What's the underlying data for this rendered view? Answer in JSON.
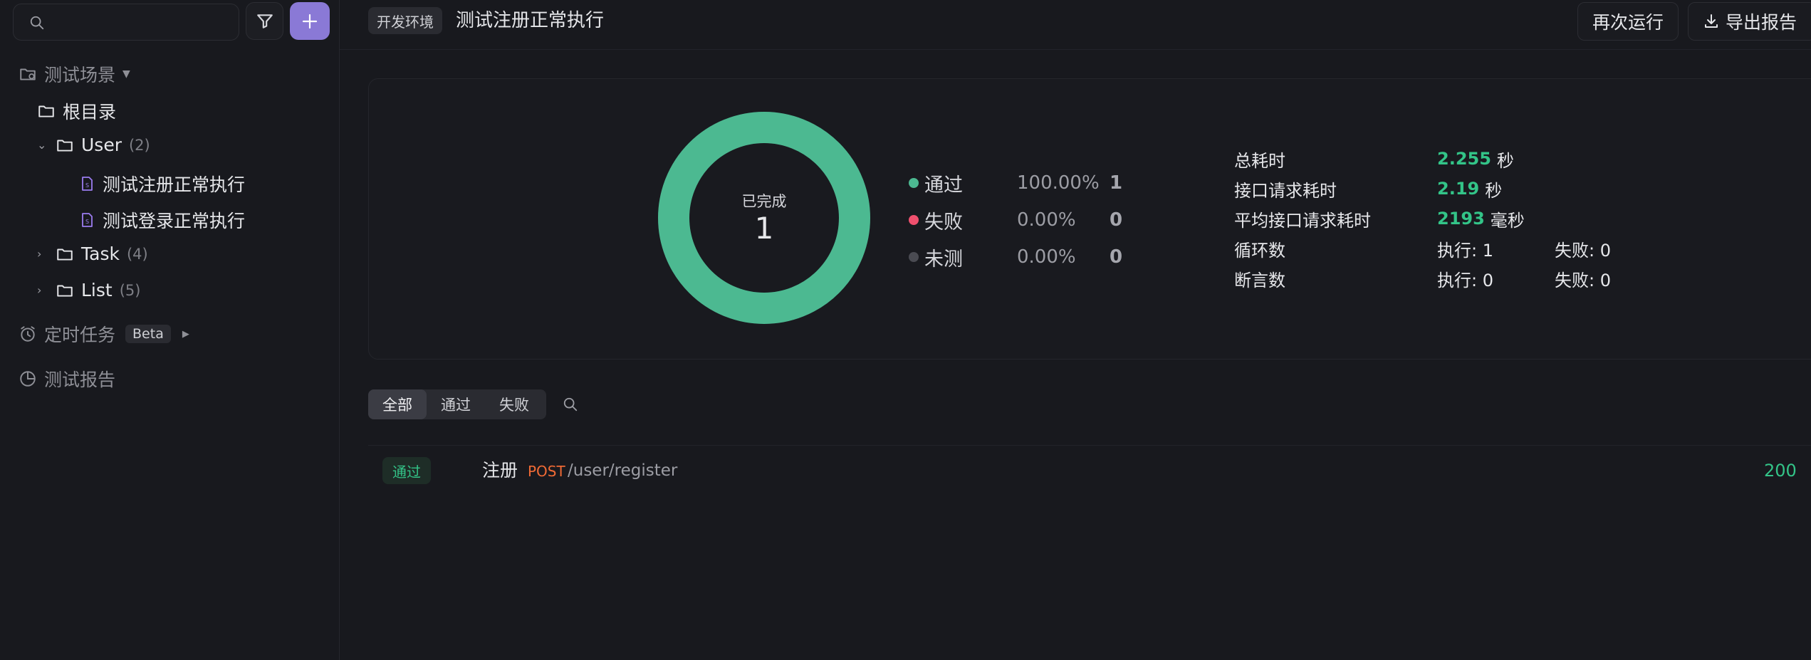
{
  "sidebar": {
    "search": {
      "placeholder": "",
      "value": ""
    },
    "sections": {
      "scenarios": "测试场景",
      "scheduled": "定时任务",
      "beta": "Beta",
      "reports": "测试报告"
    },
    "tree": {
      "root": "根目录",
      "user": {
        "label": "User",
        "count": "(2)"
      },
      "case1": "测试注册正常执行",
      "case2": "测试登录正常执行",
      "task": {
        "label": "Task",
        "count": "(4)"
      },
      "list": {
        "label": "List",
        "count": "(5)"
      }
    }
  },
  "header": {
    "env": "开发环境",
    "title": "测试注册正常执行",
    "rerun": "再次运行",
    "export": "导出报告"
  },
  "summary": {
    "donut": {
      "label": "已完成",
      "value": "1",
      "pass_fraction": 1.0,
      "color": "#4cb991"
    },
    "legend": [
      {
        "label": "通过",
        "pct": "100.00%",
        "count": "1",
        "color": "#4cb991"
      },
      {
        "label": "失败",
        "pct": "0.00%",
        "count": "0",
        "color": "#f0506e"
      },
      {
        "label": "未测",
        "pct": "0.00%",
        "count": "0",
        "color": "#4a4b52"
      }
    ],
    "stats": {
      "total_time": {
        "k": "总耗时",
        "v": "2.255",
        "unit": "秒"
      },
      "req_time": {
        "k": "接口请求耗时",
        "v": "2.19",
        "unit": "秒"
      },
      "avg_time": {
        "k": "平均接口请求耗时",
        "v": "2193",
        "unit": "毫秒"
      },
      "loops": {
        "k": "循环数",
        "exec": "执行: 1",
        "fail": "失败: 0"
      },
      "asserts": {
        "k": "断言数",
        "exec": "执行: 0",
        "fail": "失败: 0"
      }
    }
  },
  "results": {
    "tabs": [
      "全部",
      "通过",
      "失败"
    ],
    "rows": [
      {
        "status": "通过",
        "name": "注册",
        "method": "POST",
        "path": "/user/register",
        "code": "200"
      }
    ]
  }
}
